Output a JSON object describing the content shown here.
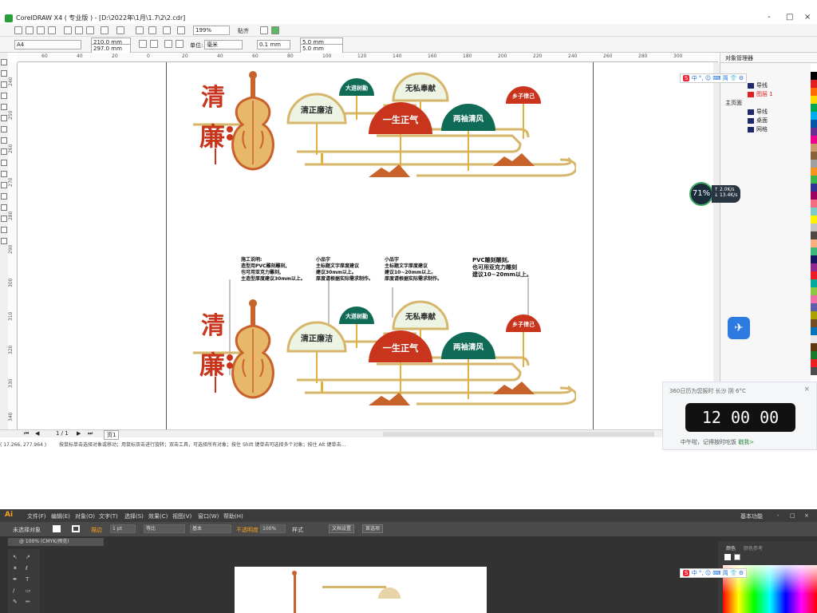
{
  "coreldraw": {
    "title": "CorelDRAW X4 ( 专业版 ) - [D:\\2022年\\1月\\1.7\\2\\2.cdr]",
    "window_controls": [
      "-",
      "□",
      "×"
    ],
    "zoom": "199%",
    "snap_label": "贴齐",
    "page_size": "A4",
    "width_val": "210.0 mm",
    "height_val": "297.0 mm",
    "unit_label": "单位:",
    "unit_value": "毫米",
    "nudge_value": "0.1 mm",
    "dup_x": "5.0 mm",
    "dup_y": "5.0 mm",
    "ruler_h": [
      "60",
      "40",
      "20",
      "0",
      "20",
      "40",
      "60",
      "80",
      "100",
      "120",
      "140",
      "160",
      "180",
      "200",
      "220",
      "240",
      "260",
      "280",
      "300"
    ],
    "ruler_v": [
      "240",
      "250",
      "260",
      "270",
      "280",
      "290",
      "300",
      "310",
      "320",
      "330",
      "340"
    ],
    "page_nav": "1 / 1",
    "page_tab": "页1",
    "status_coords": "( 17.266, 277.964 )",
    "status_text": "按鼠标单击选择对象或移动；用鼠标双击进行旋转；双击工具，可选择所有对象；按住 Shift 键单击可选择多个对象；按住 Alt 键单击…"
  },
  "object_manager": {
    "title": "对象管理器",
    "tree": [
      {
        "label": "导线",
        "color": "#222222"
      },
      {
        "label": "图层 1",
        "color": "#e02020"
      },
      {
        "label": "主页面",
        "color": "#222222"
      },
      {
        "label": "导线",
        "color": "#222222"
      },
      {
        "label": "桌面",
        "color": "#222222"
      },
      {
        "label": "网格",
        "color": "#222222"
      }
    ]
  },
  "perf_widget": {
    "percent": "71%",
    "up": "2.0K/s",
    "down": "13.4K/s"
  },
  "clock_widget": {
    "header": "360日历为您报时 长沙 阴 6°C",
    "time": "12  00  00",
    "message": "中午啦，记得按时吃饭",
    "link": "戳我>"
  },
  "ime_bar": {
    "items": [
      "中",
      "°,",
      "☺",
      "⌨",
      "简",
      "👕",
      "⚙"
    ]
  },
  "design": {
    "title_char_1": "清",
    "title_char_2": "廉",
    "fans": [
      {
        "text": "大道树勤",
        "color": "#0f6b55"
      },
      {
        "text": "无私奉献",
        "color": "#d6b66a"
      },
      {
        "text": "清正廉洁",
        "color": "#d6b66a"
      },
      {
        "text": "一生正气",
        "color": "#c8341c"
      },
      {
        "text": "两袖清风",
        "color": "#0f6b55"
      },
      {
        "text": "乡子律己",
        "color": "#c8341c"
      }
    ],
    "notes": [
      "施工说明:\n造型用PVC雕刻雕刻,\n也可用亚克力雕刻,\n主造型厚度建议30mm以上。",
      "小品字\n主标题文字厚度建议\n建议30mm以上。\n厚度请根据实际需求制作。",
      "小品字\n主标题文字厚度建议\n建议10~20mm以上。\n厚度请根据实际需求制作。",
      "PVC雕刻雕刻,\n也可用亚克力雕刻\n建议10~20mm以上。"
    ]
  },
  "illustrator": {
    "logo": "Ai",
    "menu": [
      "文件(F)",
      "编辑(E)",
      "对象(O)",
      "文字(T)",
      "选择(S)",
      "效果(C)",
      "视图(V)",
      "窗口(W)",
      "帮助(H)"
    ],
    "workspace": "基本功能",
    "window_controls": [
      "-",
      "□",
      "×"
    ],
    "ctrl_unselected": "未选择对象",
    "stroke_label": "描边",
    "stroke_value": "1 pt",
    "profile_label": "等比",
    "brush_label": "基本",
    "opacity_label": "不透明度",
    "opacity_value": "100%",
    "style_label": "样式",
    "doc_setup": "文档设置",
    "prefs": "首选项",
    "doc_tab": "@ 100% (CMYK/预览)",
    "panel_tabs": [
      "颜色",
      "颜色参考"
    ]
  },
  "colors": {
    "red": "#c8341c",
    "green": "#0f6b55",
    "gold": "#d6b66a",
    "wood": "#e8b86a",
    "orange_dark": "#c7622a"
  }
}
